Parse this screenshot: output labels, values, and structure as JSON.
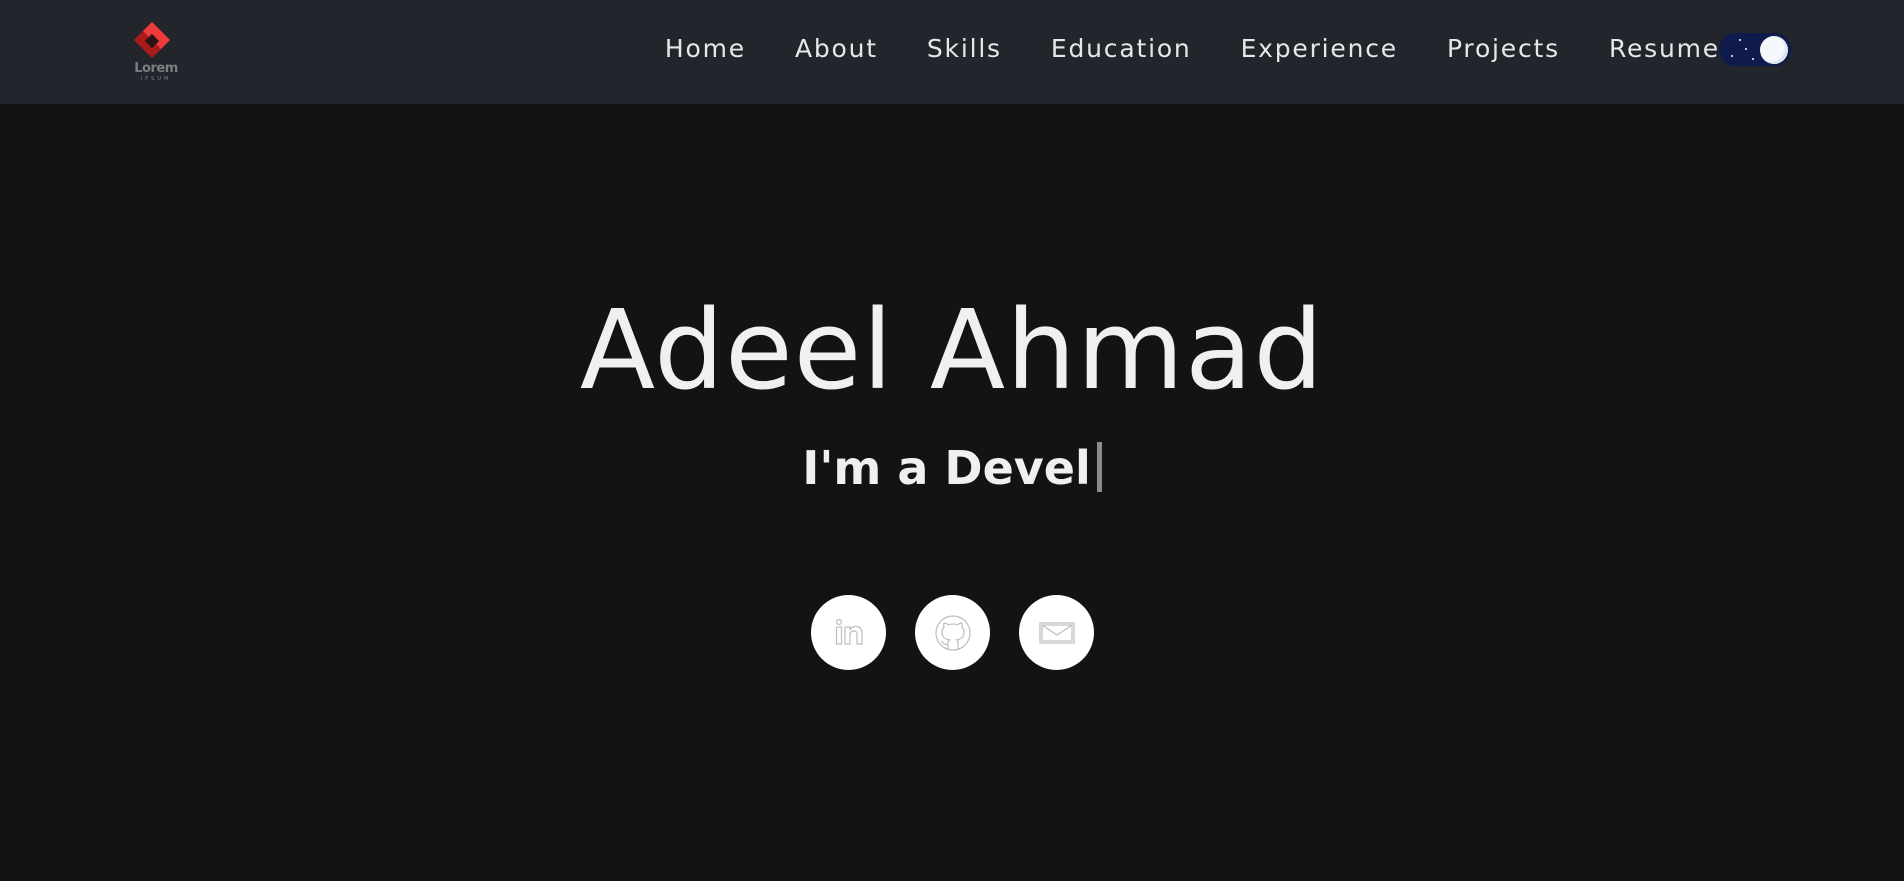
{
  "logo": {
    "text": "Lorem",
    "subtext": "IPSUM",
    "icon": "diamond-logo-icon",
    "color": "#d32f2f"
  },
  "nav": {
    "items": [
      {
        "label": "Home"
      },
      {
        "label": "About"
      },
      {
        "label": "Skills"
      },
      {
        "label": "Education"
      },
      {
        "label": "Experience"
      },
      {
        "label": "Projects"
      },
      {
        "label": "Resume"
      }
    ],
    "theme_toggle": {
      "icon": "moon-icon",
      "state": "dark"
    }
  },
  "hero": {
    "name": "Adeel Ahmad",
    "subtitle": "I'm a Devel"
  },
  "socials": [
    {
      "icon": "linkedin-icon"
    },
    {
      "icon": "github-icon"
    },
    {
      "icon": "mail-icon"
    }
  ],
  "colors": {
    "background": "#131313",
    "navbar": "#22262c",
    "text": "#f0f0f0",
    "toggle_track": "#0f1b4d"
  }
}
